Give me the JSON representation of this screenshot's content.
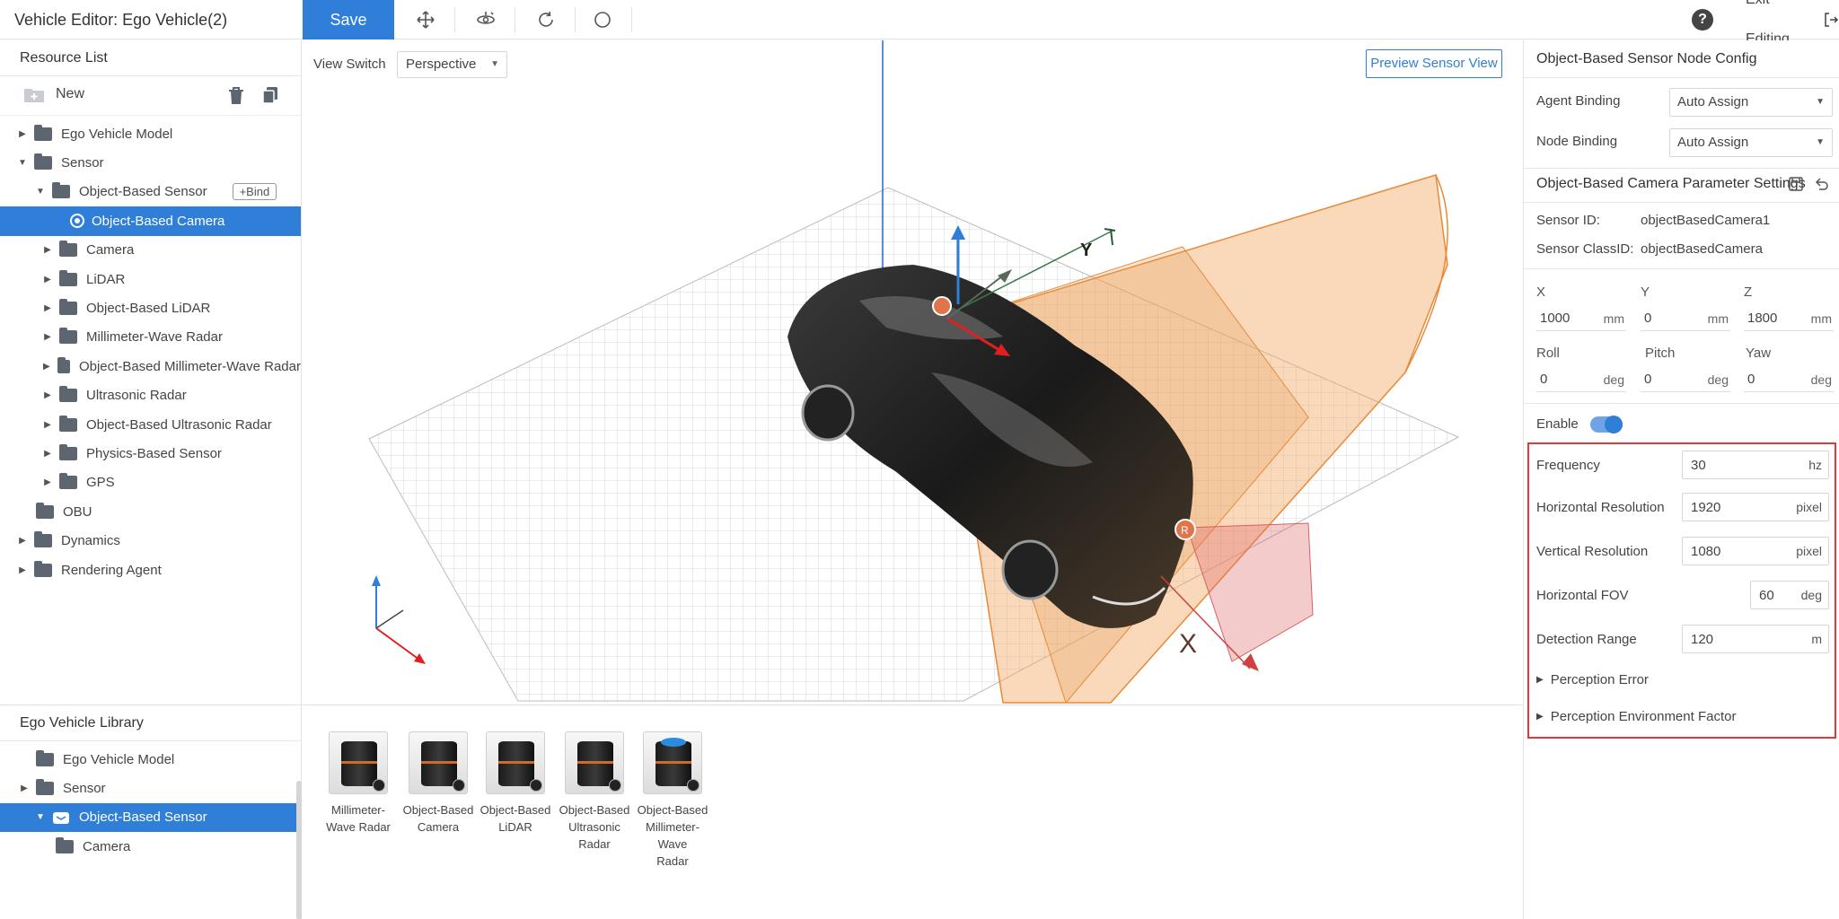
{
  "topbar": {
    "title": "Vehicle Editor: Ego Vehicle(2)",
    "save_label": "Save",
    "exit_label": "Exit Editing",
    "help_glyph": "?",
    "tools": [
      "move-icon",
      "rotate-view-icon",
      "rotate-icon",
      "circle-icon"
    ]
  },
  "resource_list": {
    "title": "Resource List",
    "new_label": "New",
    "items": [
      {
        "label": "Ego Vehicle Model",
        "caret": "▶",
        "icon": "folder"
      },
      {
        "label": "Sensor",
        "caret": "▼",
        "icon": "folder-open"
      },
      {
        "label": "Object-Based Sensor",
        "caret": "▼",
        "icon": "folder-open",
        "bind": "+Bind"
      },
      {
        "label": "Object-Based Camera",
        "caret": "",
        "icon": "camera",
        "selected": true
      },
      {
        "label": "Camera",
        "caret": "▶",
        "icon": "folder"
      },
      {
        "label": "LiDAR",
        "caret": "▶",
        "icon": "folder"
      },
      {
        "label": "Object-Based LiDAR",
        "caret": "▶",
        "icon": "folder"
      },
      {
        "label": "Millimeter-Wave Radar",
        "caret": "▶",
        "icon": "folder"
      },
      {
        "label": "Object-Based Millimeter-Wave Radar",
        "caret": "▶",
        "icon": "folder"
      },
      {
        "label": "Ultrasonic Radar",
        "caret": "▶",
        "icon": "folder"
      },
      {
        "label": "Object-Based Ultrasonic Radar",
        "caret": "▶",
        "icon": "folder"
      },
      {
        "label": "Physics-Based Sensor",
        "caret": "▶",
        "icon": "folder"
      },
      {
        "label": "GPS",
        "caret": "▶",
        "icon": "folder"
      },
      {
        "label": "OBU",
        "caret": "",
        "icon": "folder"
      },
      {
        "label": "Dynamics",
        "caret": "▶",
        "icon": "folder"
      },
      {
        "label": "Rendering Agent",
        "caret": "▶",
        "icon": "folder"
      }
    ]
  },
  "library": {
    "title": "Ego Vehicle Library",
    "items": [
      {
        "label": "Ego Vehicle Model",
        "caret": ""
      },
      {
        "label": "Sensor",
        "caret": "▶"
      },
      {
        "label": "Object-Based Sensor",
        "caret": "▼",
        "selected": true
      },
      {
        "label": "Camera",
        "caret": ""
      }
    ]
  },
  "viewport": {
    "view_switch_label": "View Switch",
    "view_mode": "Perspective",
    "preview_label": "Preview Sensor View",
    "axis_x": "X",
    "axis_y": "Y",
    "sensor_marker": "R"
  },
  "models": [
    {
      "line1": "Millimeter-",
      "line2": "Wave Radar",
      "line3": ""
    },
    {
      "line1": "Object-Based",
      "line2": "Camera",
      "line3": ""
    },
    {
      "line1": "Object-Based",
      "line2": "LiDAR",
      "line3": ""
    },
    {
      "line1": "Object-Based",
      "line2": "Ultrasonic Radar",
      "line3": ""
    },
    {
      "line1": "Object-Based",
      "line2": "Millimeter-Wave",
      "line3": "Radar"
    }
  ],
  "config": {
    "title": "Object-Based Sensor Node Config",
    "agent_binding_label": "Agent Binding",
    "agent_binding_value": "Auto Assign",
    "node_binding_label": "Node Binding",
    "node_binding_value": "Auto Assign",
    "camera_settings_title": "Object-Based Camera Parameter Settings",
    "sensor_id_label": "Sensor ID:",
    "sensor_id_value": "objectBasedCamera1",
    "sensor_class_label": "Sensor ClassID:",
    "sensor_class_value": "objectBasedCamera",
    "position": {
      "x_label": "X",
      "x_value": "1000",
      "x_unit": "mm",
      "y_label": "Y",
      "y_value": "0",
      "y_unit": "mm",
      "z_label": "Z",
      "z_value": "1800",
      "z_unit": "mm"
    },
    "rotation": {
      "roll_label": "Roll",
      "roll_value": "0",
      "roll_unit": "deg",
      "pitch_label": "Pitch",
      "pitch_value": "0",
      "pitch_unit": "deg",
      "yaw_label": "Yaw",
      "yaw_value": "0",
      "yaw_unit": "deg"
    },
    "enable_label": "Enable",
    "enabled": true,
    "params": {
      "frequency_label": "Frequency",
      "frequency_value": "30",
      "frequency_unit": "hz",
      "hres_label": "Horizontal Resolution",
      "hres_value": "1920",
      "hres_unit": "pixel",
      "vres_label": "Vertical Resolution",
      "vres_value": "1080",
      "vres_unit": "pixel",
      "hfov_label": "Horizontal FOV",
      "hfov_value": "60",
      "hfov_unit": "deg",
      "range_label": "Detection Range",
      "range_value": "120",
      "range_unit": "m"
    },
    "perception_error_label": "Perception Error",
    "perception_env_label": "Perception Environment Factor"
  },
  "colors": {
    "accent": "#2f7fd8",
    "highlight": "#e53935",
    "fov": "#f0a45a"
  }
}
